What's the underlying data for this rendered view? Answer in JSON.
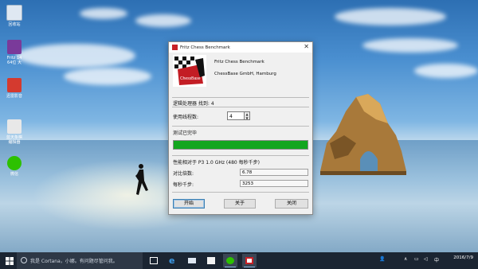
{
  "desktop": {
    "icons": [
      {
        "label": "回收站",
        "icon": "recycle-bin-icon",
        "color": "#dfe8f2"
      },
      {
        "label": "Fritz 14\n64位 大",
        "icon": "fritz-icon",
        "color": "#7a3a9a"
      },
      {
        "label": "迅雷影音",
        "icon": "player-icon",
        "color": "#d43a2f"
      },
      {
        "label": "蓝天象棋 编辑器",
        "icon": "chess-app-icon",
        "color": "#e8e8e8"
      },
      {
        "label": "微信",
        "icon": "wechat-icon",
        "color": "#2dc100"
      }
    ]
  },
  "window": {
    "title": "Fritz Chess Benchmark",
    "product": "Fritz Chess Benchmark",
    "company": "ChessBase GmbH, Hamburg",
    "logo_text": "ChessBase",
    "logical_processors": "逻辑处理器 找到: 4",
    "threads_label": "使用线程数:",
    "threads_value": "4",
    "status": "测试已完毕",
    "progress_fraction": 1.0,
    "progress_color": "#13a61f",
    "perf_label": "性能相对于 P3 1.0 GHz (480 每秒千步)",
    "ratio_label": "对比倍数:",
    "ratio_value": "6.78",
    "knps_label": "每秒千步:",
    "knps_value": "3253",
    "buttons": {
      "start": "开始",
      "about": "关于",
      "close": "关闭"
    }
  },
  "taskbar": {
    "search_placeholder": "我是 Cortana，小娜。有问题尽管问我。",
    "apps": [
      "task-view-icon",
      "edge-icon",
      "mail-icon",
      "store-icon",
      "wechat-icon",
      "fritz-icon"
    ],
    "tray_lang": "中",
    "date": "2016/7/9"
  }
}
